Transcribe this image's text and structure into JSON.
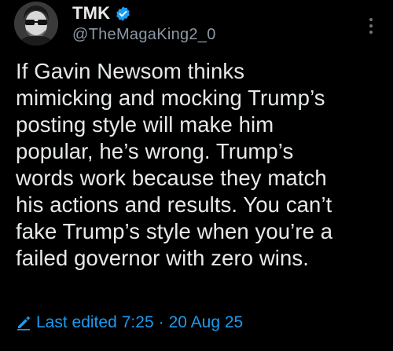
{
  "author": {
    "display_name": "TMK",
    "handle": "@TheMagaKing2_0",
    "verified_icon": "verified-badge-icon",
    "avatar_icon": "avatar-sunglasses"
  },
  "tweet": {
    "lines": [
      "If Gavin Newsom thinks",
      "mimicking and mocking Trump’s",
      "posting style will make him",
      "popular, he’s wrong. Trump’s",
      "words work because they match",
      "his actions and results. You can’t",
      "fake Trump’s style when you’re a",
      "failed governor with zero wins."
    ]
  },
  "edit_info": {
    "label": "Last edited",
    "time": "7:25",
    "separator": "·",
    "date": "20 Aug 25"
  },
  "colors": {
    "background": "#000000",
    "text": "#e7e9ea",
    "secondary": "#8b98a5",
    "accent": "#1d9bf0"
  }
}
